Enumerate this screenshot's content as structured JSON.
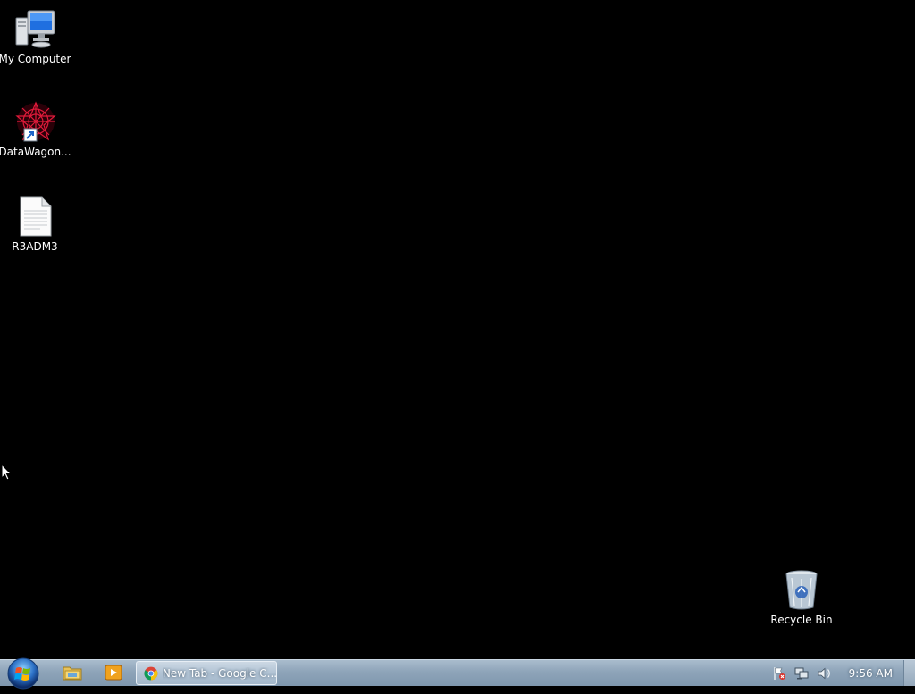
{
  "desktop": {
    "icons": [
      {
        "label": "My Computer",
        "icon": "computer-icon"
      },
      {
        "label": "DataWagon...",
        "icon": "datawagon-shortcut-icon"
      },
      {
        "label": "R3ADM3",
        "icon": "text-document-icon"
      },
      {
        "label": "Recycle Bin",
        "icon": "recycle-bin-icon"
      }
    ]
  },
  "taskbar": {
    "start_icon": "windows-start-orb",
    "pinned": [
      {
        "icon": "windows-explorer-icon"
      },
      {
        "icon": "media-player-icon"
      }
    ],
    "tasks": [
      {
        "title": "New Tab - Google C...",
        "icon": "chrome-icon",
        "active": true
      }
    ],
    "tray": {
      "icons": [
        "action-center-flag-icon",
        "network-icon",
        "volume-icon"
      ],
      "clock": "9:56 AM"
    }
  },
  "colors": {
    "desktop_background": "#000000",
    "taskbar": "#8ea4b9"
  }
}
